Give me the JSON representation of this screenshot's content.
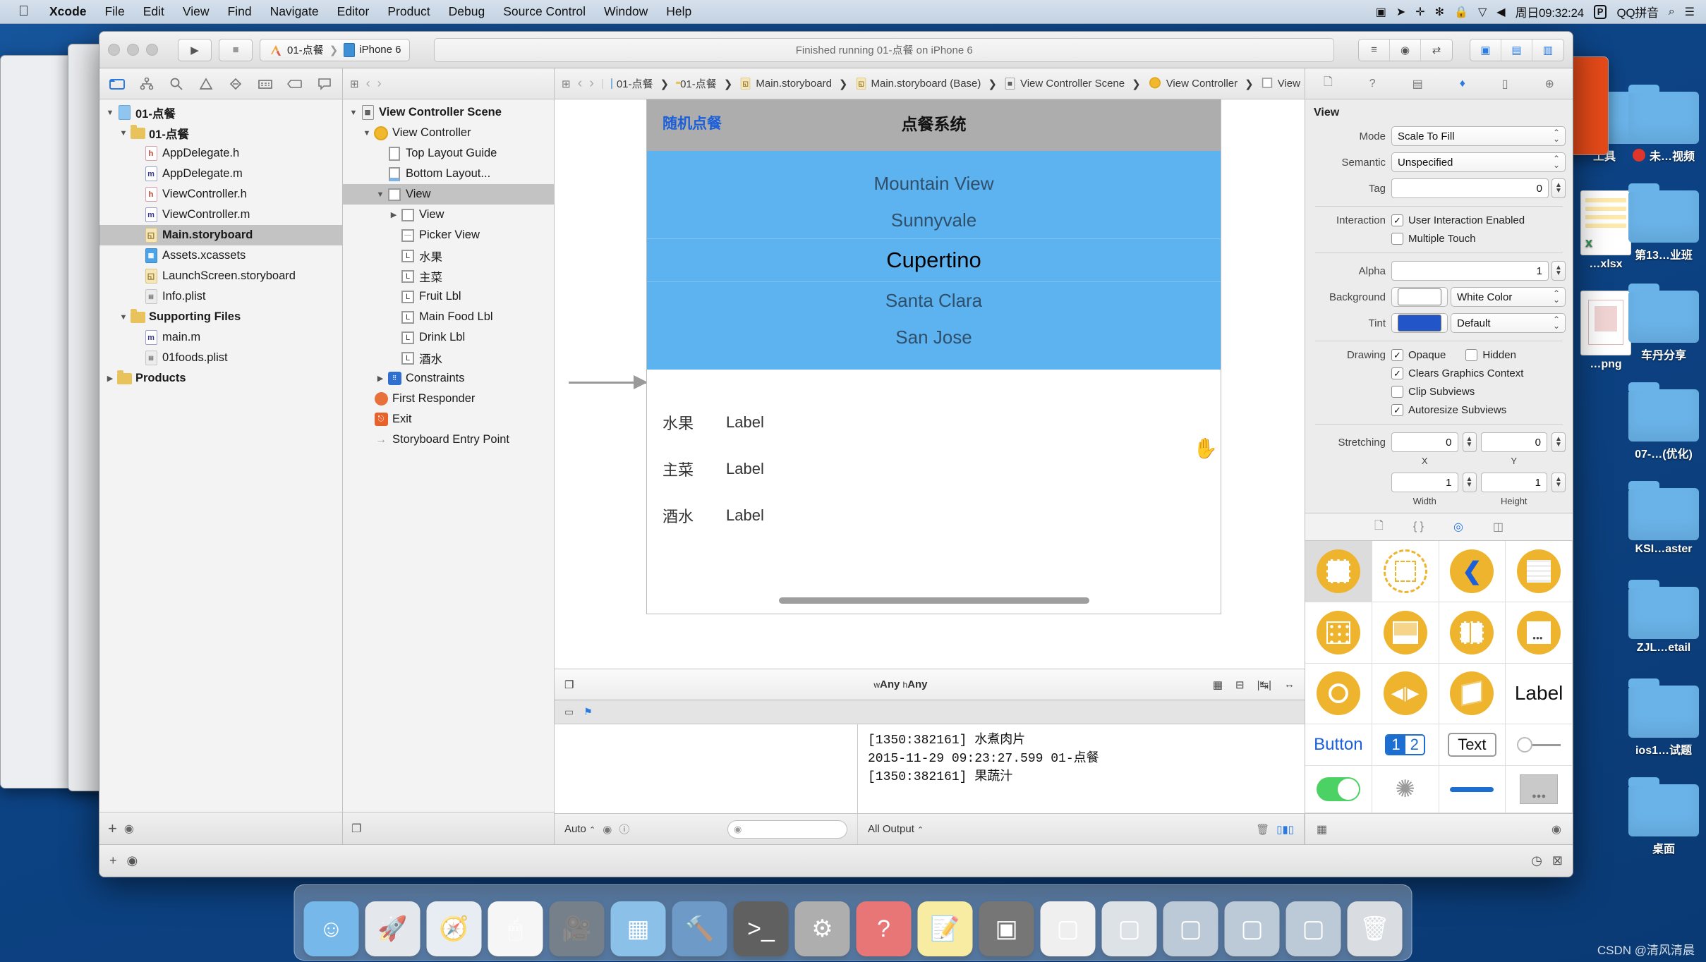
{
  "menubar": {
    "apple_icon": "apple-icon",
    "items": [
      {
        "label": "Xcode",
        "bold": true
      },
      {
        "label": "File",
        "bold": false
      },
      {
        "label": "Edit",
        "bold": false
      },
      {
        "label": "View",
        "bold": false
      },
      {
        "label": "Find",
        "bold": false
      },
      {
        "label": "Navigate",
        "bold": false
      },
      {
        "label": "Editor",
        "bold": false
      },
      {
        "label": "Product",
        "bold": false
      },
      {
        "label": "Debug",
        "bold": false
      },
      {
        "label": "Source Control",
        "bold": false
      },
      {
        "label": "Window",
        "bold": false
      },
      {
        "label": "Help",
        "bold": false
      }
    ],
    "status": {
      "screen_recorder": "▣",
      "location": "➤",
      "dropbox": "✛",
      "bluetooth": "✻",
      "lock": "🔒",
      "wifi": "▽",
      "volume": "◀",
      "clock": "周日09:32:24",
      "input_badge": "P",
      "input_method": "QQ拼音",
      "search": "⌕",
      "notification": "☰"
    }
  },
  "desktop_icons": [
    {
      "label": "工具",
      "type": "folder"
    },
    {
      "label": "未…视频",
      "type": "folder",
      "badge": true
    },
    {
      "label": "…xlsx",
      "type": "spreadsheet"
    },
    {
      "label": "第13…业班",
      "type": "folder"
    },
    {
      "label": "…png",
      "type": "image"
    },
    {
      "label": "车丹分享",
      "type": "folder"
    },
    {
      "label": "07-…(优化)",
      "type": "folder"
    },
    {
      "label": "KSI…aster",
      "type": "folder"
    },
    {
      "label": "ZJL…etail",
      "type": "folder"
    },
    {
      "label": "ios1…试题",
      "type": "folder"
    },
    {
      "label": "桌面",
      "type": "folder"
    }
  ],
  "xcode": {
    "toolbar": {
      "run_label": "▶",
      "stop_label": "■",
      "scheme_project": "01-点餐",
      "scheme_device": "iPhone 6",
      "activity_status": "Finished running 01-点餐 on iPhone 6",
      "editor_segments": [
        "≡",
        "◉",
        "⇄"
      ],
      "view_segments": [
        "▣",
        "▤",
        "▥"
      ]
    },
    "navigator": {
      "tabs": [
        "folder-icon",
        "sourcecontrol-icon",
        "search-icon",
        "warning-icon",
        "breakpoint-icon",
        "test-icon",
        "tag-icon",
        "report-icon"
      ],
      "active_tab_index": 0,
      "tree": [
        {
          "label": "01-点餐",
          "depth": 0,
          "twisty": "▼",
          "icon": "project",
          "selected": false
        },
        {
          "label": "01-点餐",
          "depth": 1,
          "twisty": "▼",
          "icon": "folder",
          "selected": false
        },
        {
          "label": "AppDelegate.h",
          "depth": 2,
          "twisty": "",
          "icon": "h",
          "selected": false
        },
        {
          "label": "AppDelegate.m",
          "depth": 2,
          "twisty": "",
          "icon": "m",
          "selected": false
        },
        {
          "label": "ViewController.h",
          "depth": 2,
          "twisty": "",
          "icon": "h",
          "selected": false
        },
        {
          "label": "ViewController.m",
          "depth": 2,
          "twisty": "",
          "icon": "m",
          "selected": false
        },
        {
          "label": "Main.storyboard",
          "depth": 2,
          "twisty": "",
          "icon": "storyboard",
          "selected": true
        },
        {
          "label": "Assets.xcassets",
          "depth": 2,
          "twisty": "",
          "icon": "assets",
          "selected": false
        },
        {
          "label": "LaunchScreen.storyboard",
          "depth": 2,
          "twisty": "",
          "icon": "storyboard",
          "selected": false
        },
        {
          "label": "Info.plist",
          "depth": 2,
          "twisty": "",
          "icon": "plist",
          "selected": false
        },
        {
          "label": "Supporting Files",
          "depth": 1,
          "twisty": "▼",
          "icon": "folder",
          "selected": false
        },
        {
          "label": "main.m",
          "depth": 2,
          "twisty": "",
          "icon": "m",
          "selected": false
        },
        {
          "label": "01foods.plist",
          "depth": 2,
          "twisty": "",
          "icon": "plist",
          "selected": false
        },
        {
          "label": "Products",
          "depth": 0,
          "twisty": "▶",
          "icon": "folder",
          "selected": false
        }
      ],
      "footer_add": "+",
      "footer_filter_placeholder": ""
    },
    "outline": {
      "tree": [
        {
          "label": "View Controller Scene",
          "depth": 0,
          "twisty": "▼",
          "icon": "scene",
          "selected": false,
          "bold": true
        },
        {
          "label": "View Controller",
          "depth": 1,
          "twisty": "▼",
          "icon": "vc",
          "selected": false
        },
        {
          "label": "Top Layout Guide",
          "depth": 2,
          "twisty": "",
          "icon": "guide-top",
          "selected": false
        },
        {
          "label": "Bottom Layout...",
          "depth": 2,
          "twisty": "",
          "icon": "guide-bottom",
          "selected": false
        },
        {
          "label": "View",
          "depth": 2,
          "twisty": "▼",
          "icon": "view",
          "selected": true
        },
        {
          "label": "View",
          "depth": 3,
          "twisty": "▶",
          "icon": "view",
          "selected": false
        },
        {
          "label": "Picker View",
          "depth": 3,
          "twisty": "",
          "icon": "picker",
          "selected": false
        },
        {
          "label": "水果",
          "depth": 3,
          "twisty": "",
          "icon": "label",
          "selected": false
        },
        {
          "label": "主菜",
          "depth": 3,
          "twisty": "",
          "icon": "label",
          "selected": false
        },
        {
          "label": "Fruit Lbl",
          "depth": 3,
          "twisty": "",
          "icon": "label",
          "selected": false
        },
        {
          "label": "Main Food Lbl",
          "depth": 3,
          "twisty": "",
          "icon": "label",
          "selected": false
        },
        {
          "label": "Drink Lbl",
          "depth": 3,
          "twisty": "",
          "icon": "label",
          "selected": false
        },
        {
          "label": "酒水",
          "depth": 3,
          "twisty": "",
          "icon": "label",
          "selected": false
        },
        {
          "label": "Constraints",
          "depth": 2,
          "twisty": "▶",
          "icon": "constraints",
          "selected": false
        },
        {
          "label": "First Responder",
          "depth": 1,
          "twisty": "",
          "icon": "responder",
          "selected": false
        },
        {
          "label": "Exit",
          "depth": 1,
          "twisty": "",
          "icon": "exit",
          "selected": false
        },
        {
          "label": "Storyboard Entry Point",
          "depth": 1,
          "twisty": "",
          "icon": "entry",
          "selected": false
        }
      ]
    },
    "breadcrumb": [
      {
        "label": "01-点餐",
        "icon": "project"
      },
      {
        "label": "01-点餐",
        "icon": "folder"
      },
      {
        "label": "Main.storyboard",
        "icon": "storyboard"
      },
      {
        "label": "Main.storyboard (Base)",
        "icon": "storyboard"
      },
      {
        "label": "View Controller Scene",
        "icon": "scene"
      },
      {
        "label": "View Controller",
        "icon": "vc"
      },
      {
        "label": "View",
        "icon": "view"
      }
    ],
    "canvas": {
      "nav_left_button": "随机点餐",
      "nav_title": "点餐系统",
      "picker_rows": [
        {
          "text": "Mountain View",
          "selected": false
        },
        {
          "text": "Sunnyvale",
          "selected": false
        },
        {
          "text": "Cupertino",
          "selected": true
        },
        {
          "text": "Santa Clara",
          "selected": false
        },
        {
          "text": "San Jose",
          "selected": false
        }
      ],
      "label_rows": [
        {
          "key": "水果",
          "value": "Label"
        },
        {
          "key": "主菜",
          "value": "Label"
        },
        {
          "key": "酒水",
          "value": "Label"
        }
      ],
      "size_class": "wAny hAny",
      "size_class_w": "w",
      "size_class_h": "h"
    },
    "inspector": {
      "title": "View",
      "mode_label": "Mode",
      "mode_value": "Scale To Fill",
      "semantic_label": "Semantic",
      "semantic_value": "Unspecified",
      "tag_label": "Tag",
      "tag_value": "0",
      "interaction_label": "Interaction",
      "interaction_user_enabled": {
        "label": "User Interaction Enabled",
        "checked": true
      },
      "interaction_multiple_touch": {
        "label": "Multiple Touch",
        "checked": false
      },
      "alpha_label": "Alpha",
      "alpha_value": "1",
      "background_label": "Background",
      "background_value": "White Color",
      "background_color": "#ffffff",
      "tint_label": "Tint",
      "tint_value": "Default",
      "tint_color": "#2255c8",
      "drawing_label": "Drawing",
      "drawing_opaque": {
        "label": "Opaque",
        "checked": true
      },
      "drawing_hidden": {
        "label": "Hidden",
        "checked": false
      },
      "drawing_clears": {
        "label": "Clears Graphics Context",
        "checked": true
      },
      "drawing_clip": {
        "label": "Clip Subviews",
        "checked": false
      },
      "drawing_autoresize": {
        "label": "Autoresize Subviews",
        "checked": true
      },
      "stretching_label": "Stretching",
      "stretch_x": "0",
      "stretch_y": "0",
      "stretch_x_sub": "X",
      "stretch_y_sub": "Y",
      "stretch_w": "1",
      "stretch_h": "1",
      "stretch_w_sub": "Width",
      "stretch_h_sub": "Height"
    },
    "library": {
      "tabs": [
        "file-template-icon",
        "code-snippet-icon",
        "object-icon",
        "media-icon"
      ],
      "active_tab_index": 2,
      "items": [
        {
          "name": "view-object",
          "kind": "view",
          "selected": true
        },
        {
          "name": "container-view-object",
          "kind": "container",
          "selected": false
        },
        {
          "name": "navigation-bar-object",
          "kind": "back-chevron",
          "selected": false
        },
        {
          "name": "table-view-object",
          "kind": "lines",
          "selected": false
        },
        {
          "name": "collection-view-object",
          "kind": "grid",
          "selected": false
        },
        {
          "name": "image-view-object",
          "kind": "imagecell",
          "selected": false
        },
        {
          "name": "split-view-object",
          "kind": "split",
          "selected": false
        },
        {
          "name": "page-control-object",
          "kind": "pagecontrol",
          "selected": false
        },
        {
          "name": "activity-indicator-object",
          "kind": "circle",
          "selected": false
        },
        {
          "name": "player-view-object",
          "kind": "player",
          "selected": false
        },
        {
          "name": "scene-kit-object",
          "kind": "cube",
          "selected": false
        },
        {
          "name": "label-object",
          "kind": "text",
          "text": "Label"
        },
        {
          "name": "button-object",
          "kind": "text-blue",
          "text": "Button"
        },
        {
          "name": "stepper-object",
          "kind": "stepper",
          "text": "1 2"
        },
        {
          "name": "text-field-object",
          "kind": "text-box",
          "text": "Text"
        },
        {
          "name": "slider-object",
          "kind": "slider"
        },
        {
          "name": "switch-object",
          "kind": "switch"
        },
        {
          "name": "progress-spinner-object",
          "kind": "spinner"
        },
        {
          "name": "progress-view-object",
          "kind": "progress"
        },
        {
          "name": "toolbar-object",
          "kind": "toolbar"
        }
      ],
      "stepper_text": "1 2",
      "label_text": "Label",
      "button_text": "Button",
      "textfield_text": "Text"
    },
    "debug": {
      "console_lines": [
        "[1350:382161] 水煮肉片",
        "2015-11-29 09:23:27.599 01-点餐",
        "[1350:382161] 果蔬汁"
      ],
      "scope_label": "Auto",
      "output_label": "All Output",
      "filter_placeholder": ""
    }
  },
  "dock": {
    "items": [
      {
        "name": "finder",
        "glyph": "☺",
        "color": "#3b9ae1"
      },
      {
        "name": "launchpad",
        "glyph": "🚀",
        "color": "#d8dde2"
      },
      {
        "name": "safari",
        "glyph": "🧭",
        "color": "#dde6ee"
      },
      {
        "name": "mouse-app",
        "glyph": "🖱",
        "color": "#f2f2f2"
      },
      {
        "name": "video-app",
        "glyph": "🎥",
        "color": "#3a4a5a"
      },
      {
        "name": "photos",
        "glyph": "▦",
        "color": "#5aa7e0"
      },
      {
        "name": "xcode",
        "glyph": "🔨",
        "color": "#2f6fae"
      },
      {
        "name": "terminal",
        "glyph": "&gt;_",
        "color": "#1c1c1c"
      },
      {
        "name": "settings",
        "glyph": "⚙",
        "color": "#8c8c8c"
      },
      {
        "name": "help",
        "glyph": "?",
        "color": "#e03b3b"
      },
      {
        "name": "notes",
        "glyph": "📝",
        "color": "#f5e27a"
      },
      {
        "name": "exec",
        "glyph": "▣",
        "color": "#3b3b3b"
      },
      {
        "name": "window-1",
        "glyph": "▢",
        "color": "#e8e8e8"
      },
      {
        "name": "window-2",
        "glyph": "▢",
        "color": "#cfd6dd"
      },
      {
        "name": "window-3",
        "glyph": "▢",
        "color": "#9fb4c8"
      },
      {
        "name": "window-4",
        "glyph": "▢",
        "color": "#9fb4c8"
      },
      {
        "name": "window-5",
        "glyph": "▢",
        "color": "#9fb4c8"
      },
      {
        "name": "trash",
        "glyph": "🗑",
        "color": "#c9ced4"
      }
    ]
  },
  "watermark": "CSDN @清风清晨"
}
